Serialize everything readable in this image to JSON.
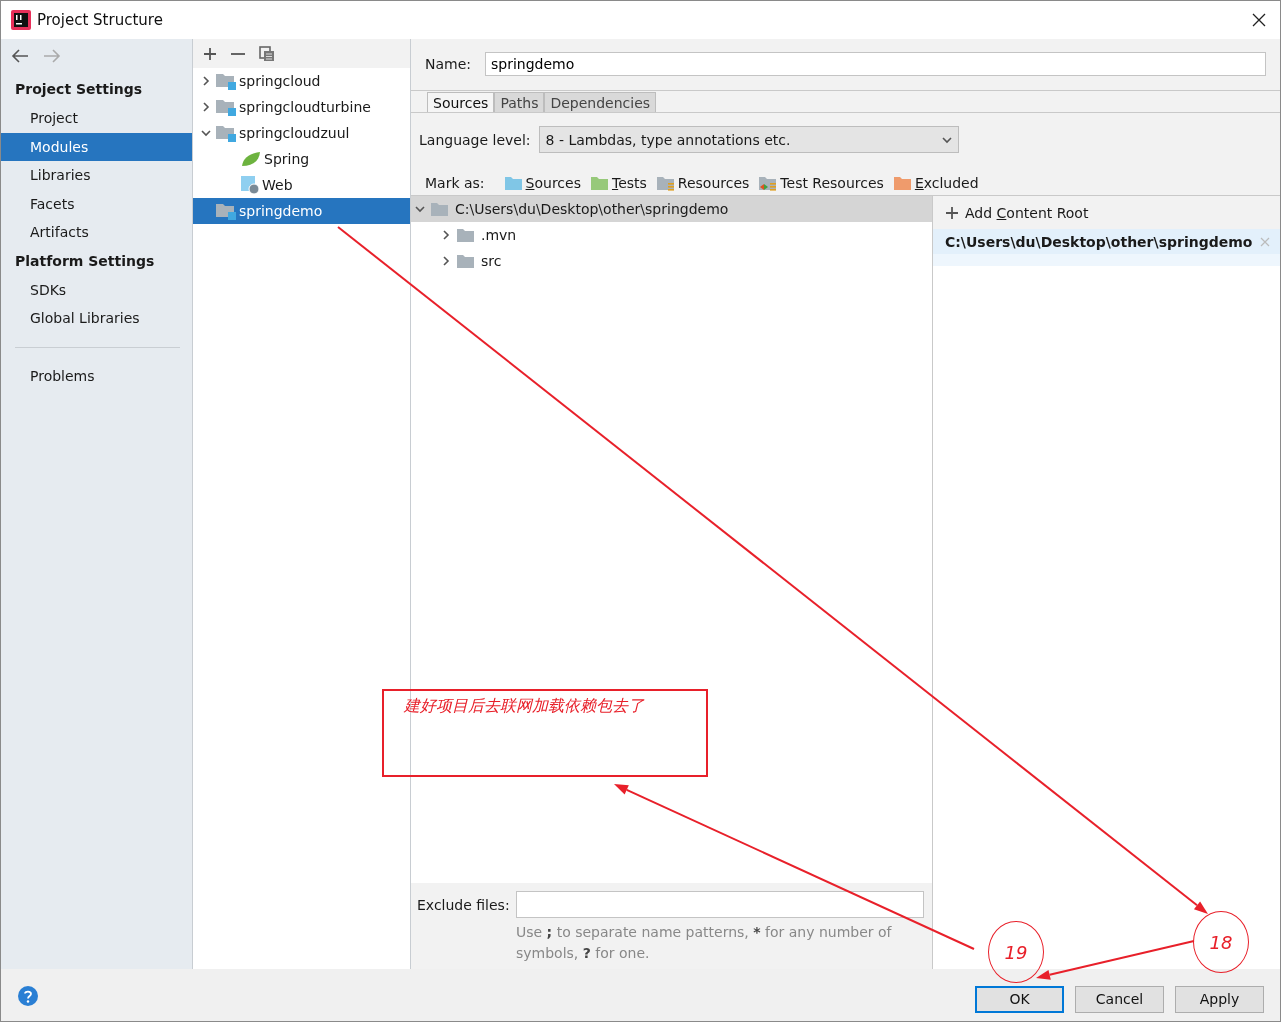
{
  "window": {
    "title": "Project Structure"
  },
  "sidebar": {
    "sections": [
      {
        "heading": "Project Settings",
        "items": [
          {
            "label": "Project",
            "selected": false
          },
          {
            "label": "Modules",
            "selected": true
          },
          {
            "label": "Libraries",
            "selected": false
          },
          {
            "label": "Facets",
            "selected": false
          },
          {
            "label": "Artifacts",
            "selected": false
          }
        ]
      },
      {
        "heading": "Platform Settings",
        "items": [
          {
            "label": "SDKs",
            "selected": false
          },
          {
            "label": "Global Libraries",
            "selected": false
          }
        ]
      }
    ],
    "extra_items": [
      {
        "label": "Problems",
        "selected": false
      }
    ]
  },
  "modules": {
    "items": [
      {
        "label": "springcloud",
        "kind": "module",
        "expanded": false,
        "selected": false
      },
      {
        "label": "springcloudturbine",
        "kind": "module",
        "expanded": false,
        "selected": false
      },
      {
        "label": "springcloudzuul",
        "kind": "module",
        "expanded": true,
        "selected": false,
        "children": [
          {
            "label": "Spring",
            "kind": "spring",
            "selected": false
          },
          {
            "label": "Web",
            "kind": "web",
            "selected": false
          }
        ]
      },
      {
        "label": "springdemo",
        "kind": "module",
        "selected": true
      }
    ]
  },
  "editor": {
    "name_label": "Name:",
    "name_value": "springdemo",
    "tabs": [
      {
        "label": "Sources",
        "selected": true
      },
      {
        "label": "Paths",
        "selected": false
      },
      {
        "label": "Dependencies",
        "selected": false
      }
    ],
    "language_level": {
      "label": "Language level:",
      "value": "8 - Lambdas, type annotations etc."
    },
    "mark_as": {
      "label": "Mark as:",
      "items": [
        {
          "label": [
            {
              "text": "S",
              "underline": true
            },
            {
              "text": "ources",
              "underline": false
            }
          ],
          "kind": "sources"
        },
        {
          "label": [
            {
              "text": "T",
              "underline": true
            },
            {
              "text": "ests",
              "underline": false
            }
          ],
          "kind": "tests"
        },
        {
          "label": [
            {
              "text": "Resources",
              "underline": false
            }
          ],
          "kind": "resources"
        },
        {
          "label": [
            {
              "text": "Test Resources",
              "underline": false
            }
          ],
          "kind": "test_resources"
        },
        {
          "label": [
            {
              "text": "E",
              "underline": true
            },
            {
              "text": "xcluded",
              "underline": false
            }
          ],
          "kind": "excluded"
        }
      ]
    },
    "tree": {
      "label": "C:\\Users\\du\\Desktop\\other\\springdemo",
      "expanded": true,
      "children": [
        {
          "label": ".mvn",
          "expanded": false
        },
        {
          "label": "src",
          "expanded": false
        }
      ]
    },
    "content_roots": {
      "add_label": [
        {
          "text": "Add ",
          "underline": false
        },
        {
          "text": "C",
          "underline": true
        },
        {
          "text": "ontent Root",
          "underline": false
        }
      ],
      "roots": [
        {
          "path": "C:\\Users\\du\\Desktop\\other\\springdemo",
          "selected": true
        }
      ]
    },
    "exclude_files": {
      "label": "Exclude files:",
      "hint": [
        {
          "text": "Use ",
          "bold": false
        },
        {
          "text": ";",
          "bold": true
        },
        {
          "text": " to separate name patterns, ",
          "bold": false
        },
        {
          "text": "*",
          "bold": true
        },
        {
          "text": " for any number of symbols, ",
          "bold": false
        },
        {
          "text": "?",
          "bold": true
        },
        {
          "text": " for one.",
          "bold": false
        }
      ]
    }
  },
  "footer": {
    "buttons": [
      {
        "label": "OK",
        "default": true
      },
      {
        "label": "Cancel",
        "default": false
      },
      {
        "label": "Apply",
        "default": false
      }
    ]
  },
  "annotations": {
    "note": "建好项目后去联网加载依赖包去了",
    "steps": [
      {
        "number": "19"
      },
      {
        "number": "18"
      }
    ]
  }
}
